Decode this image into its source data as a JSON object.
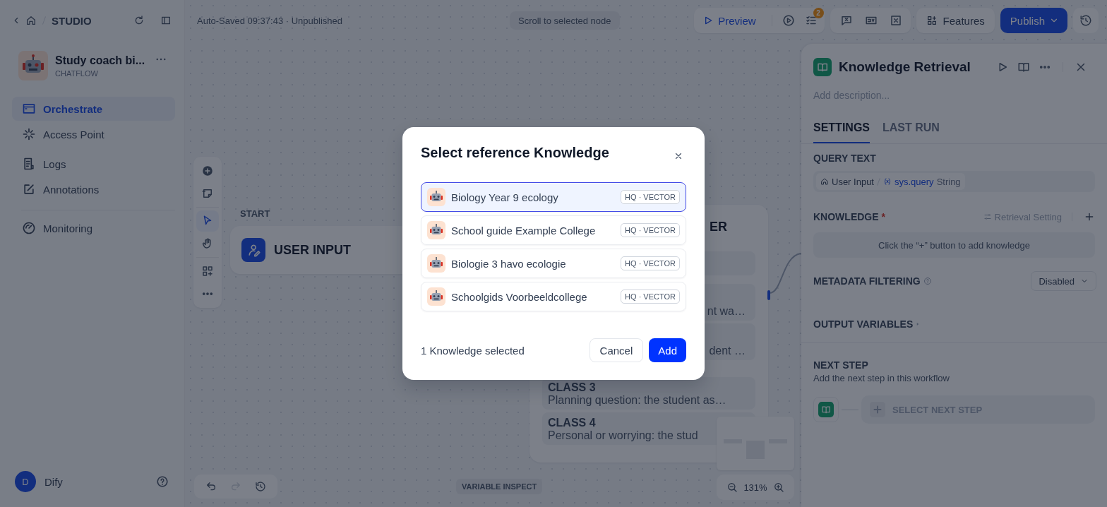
{
  "breadcrumb": {
    "section": "STUDIO"
  },
  "app": {
    "name": "Study coach bi...",
    "type": "CHATFLOW"
  },
  "nav_groups": [
    {
      "items": [
        {
          "label": "Orchestrate",
          "selected": true
        },
        {
          "label": "Access Point",
          "selected": false
        }
      ]
    },
    {
      "items": [
        {
          "label": "Logs",
          "selected": false
        },
        {
          "label": "Annotations",
          "selected": false
        }
      ]
    },
    {
      "items": [
        {
          "label": "Monitoring",
          "selected": false
        }
      ]
    }
  ],
  "user": {
    "initial": "D",
    "name": "Dify"
  },
  "topbar": {
    "status": "Auto-Saved 09:37:43 · Unpublished",
    "scroll_hint": "Scroll to selected node",
    "preview": "Preview",
    "checklist_count": "2",
    "features": "Features",
    "publish": "Publish"
  },
  "canvas_tools": [
    {
      "selected": false
    },
    {
      "selected": false
    },
    {
      "selected": true
    },
    {
      "selected": false
    },
    {
      "selected": false
    },
    {
      "selected": false
    }
  ],
  "start_node": {
    "label": "START",
    "title": "USER INPUT"
  },
  "classifier_node": {
    "title": "ER",
    "classes": [
      {
        "text": "nt wa…"
      },
      {
        "text": "dent …"
      },
      {
        "heading": "CLASS 3",
        "text": "Planning question: the student as…"
      },
      {
        "heading": "CLASS 4",
        "text": "Personal or worrying: the stud"
      }
    ]
  },
  "bottom": {
    "variable_inspect": "VARIABLE INSPECT",
    "zoom": "131%"
  },
  "panel": {
    "title": "Knowledge Retrieval",
    "description_placeholder": "Add description...",
    "tabs": [
      {
        "label": "SETTINGS",
        "selected": true
      },
      {
        "label": "LAST RUN",
        "selected": false
      }
    ],
    "query_label": "QUERY TEXT",
    "query": {
      "node": "User Input",
      "variable": "sys.query",
      "type": "String"
    },
    "knowledge_label": "KNOWLEDGE",
    "required": "*",
    "retrieval_setting": "Retrieval Setting",
    "knowledge_empty": "Click the “+” button to add knowledge",
    "metadata_label": "METADATA FILTERING",
    "metadata_value": "Disabled",
    "output_label": "OUTPUT VARIABLES",
    "next_label": "NEXT STEP",
    "next_hint": "Add the next step in this workflow",
    "select_next": "SELECT NEXT STEP"
  },
  "dialog": {
    "title": "Select reference Knowledge",
    "items": [
      {
        "name": "Biology Year 9 ecology",
        "tag": "HQ · VECTOR",
        "selected": true
      },
      {
        "name": "School guide Example College",
        "tag": "HQ · VECTOR",
        "selected": false
      },
      {
        "name": "Biologie 3 havo ecologie",
        "tag": "HQ · VECTOR",
        "selected": false
      },
      {
        "name": "Schoolgids Voorbeeldcollege",
        "tag": "HQ · VECTOR",
        "selected": false
      }
    ],
    "summary": "1 Knowledge selected",
    "cancel": "Cancel",
    "add": "Add"
  }
}
